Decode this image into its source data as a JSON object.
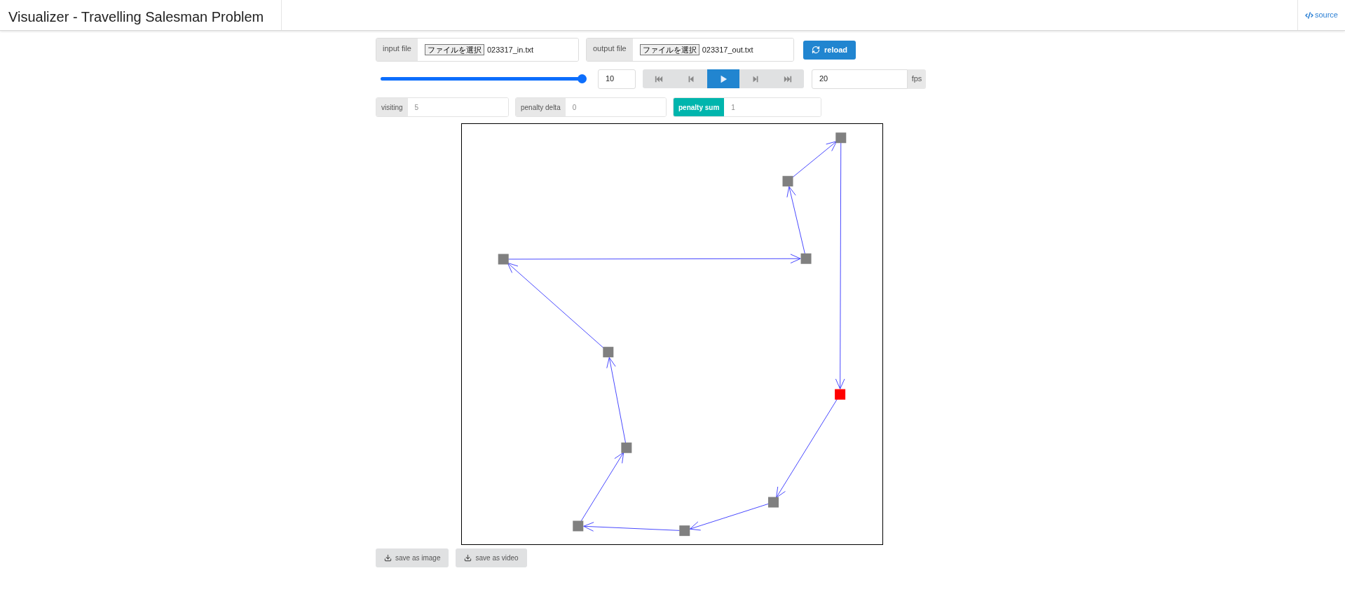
{
  "header": {
    "title": "Visualizer - Travelling Salesman Problem",
    "source_link": "source"
  },
  "input_file": {
    "label": "input file",
    "button": "ファイルを選択",
    "filename": "023317_in.txt"
  },
  "output_file": {
    "label": "output file",
    "button": "ファイルを選択",
    "filename": "023317_out.txt"
  },
  "reload_button": "reload",
  "slider": {
    "level": 1
  },
  "frame_value": "10",
  "playback_buttons": [
    {
      "kind": "first",
      "selected": false
    },
    {
      "kind": "prev",
      "selected": false
    },
    {
      "kind": "play",
      "selected": true
    },
    {
      "kind": "next",
      "selected": false
    },
    {
      "kind": "last",
      "selected": false
    }
  ],
  "fps": {
    "value": "20",
    "unit": "fps"
  },
  "stats": [
    {
      "label": "visiting",
      "value": "5",
      "highlighted": false
    },
    {
      "label": "penalty delta",
      "value": "0",
      "highlighted": false
    },
    {
      "label": "penalty sum",
      "value": "1",
      "highlighted": true
    }
  ],
  "save_buttons": [
    "save as image",
    "save as video"
  ]
}
